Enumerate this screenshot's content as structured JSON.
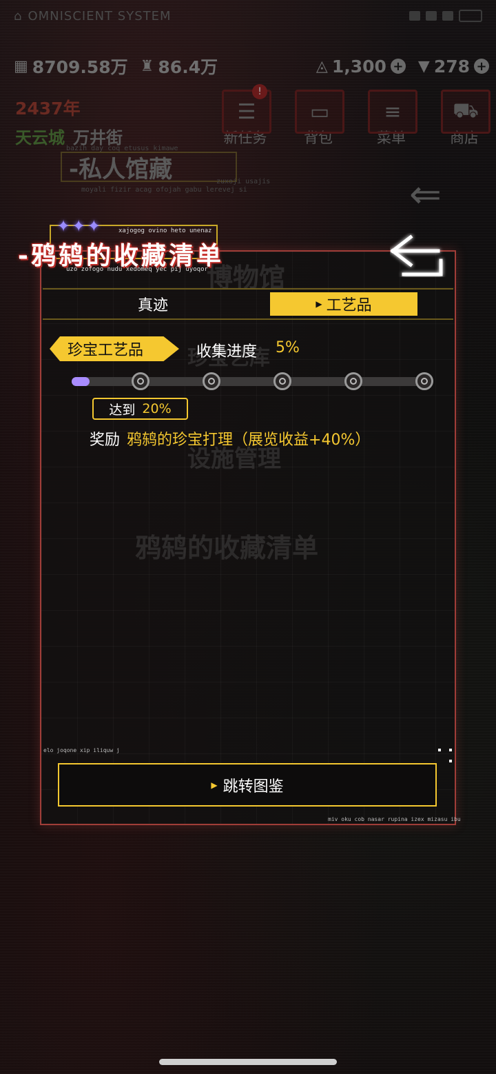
{
  "status_bar": {
    "system_name": "OMNISCIENT SYSTEM"
  },
  "resources": {
    "coins": "8709.58万",
    "people": "86.4万",
    "energy": "1,300",
    "gems": "278"
  },
  "header": {
    "year": "2437年",
    "city": "天云城",
    "street": "万井街"
  },
  "top_menu": [
    {
      "label": "新任务",
      "icon": "task-icon",
      "alert": "!"
    },
    {
      "label": "背包",
      "icon": "bag-icon"
    },
    {
      "label": "菜单",
      "icon": "menu-icon"
    },
    {
      "label": "商店",
      "icon": "shop-icon"
    }
  ],
  "background": {
    "private_collection": "-私人馆藏",
    "private_sub1": "bazih day coq etusus kimawe",
    "private_sub2": "moyali fizir acag ofojah gabu lerevej si",
    "private_sub3": "zuxoji usajis",
    "museum": "博物馆",
    "artifact_hall": "珍宝艺库",
    "facility": "设施管理",
    "collection_list": "鸦鸫的收藏清单"
  },
  "panel": {
    "stars": "✦✦✦",
    "title": "-鸦鸫的收藏清单",
    "subtitle_top": "xajogog ovino heto unenaz",
    "subtitle_bottom": "uzo zofogo nudu xedomeq yec pij uyoqor"
  },
  "tabs": [
    {
      "label": "真迹",
      "active": false
    },
    {
      "label": "工艺品",
      "active": true
    }
  ],
  "collection": {
    "category": "珍宝工艺品",
    "progress_label": "收集进度",
    "progress_value": "5%",
    "progress_fraction": 0.05,
    "milestones": 6,
    "reach_label": "达到",
    "reach_value": "20%",
    "reward_label": "奖励",
    "reward_value": "鸦鸫的珍宝打理（展览收益+40%）"
  },
  "footer": {
    "sub_top": "elo joqone xip iliquw j",
    "jump_label": "跳转图鉴",
    "sub_bottom": "miv oku cob nasar rupina izex mizasu ibu"
  },
  "colors": {
    "accent_yellow": "#f5c830",
    "panel_border": "#a03d38",
    "progress_purple": "#a98cff",
    "title_glow": "#d2322d"
  }
}
